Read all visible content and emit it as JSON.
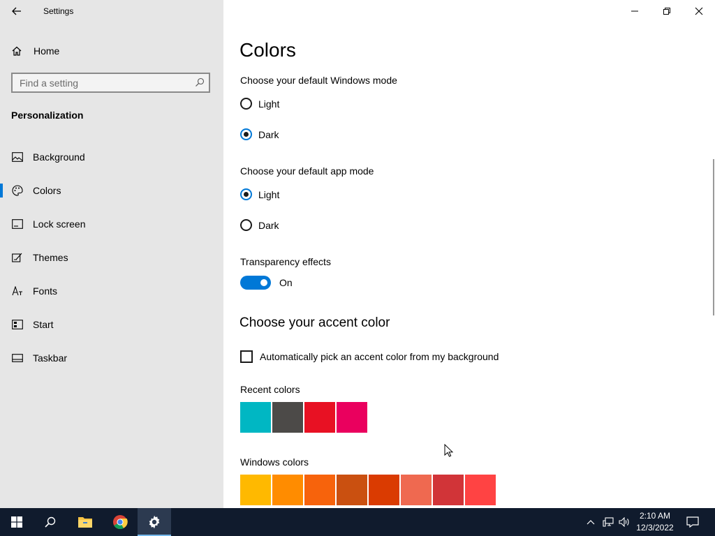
{
  "window": {
    "title": "Settings"
  },
  "sidebar": {
    "home_label": "Home",
    "search_placeholder": "Find a setting",
    "section_title": "Personalization",
    "items": [
      {
        "label": "Background",
        "icon": "image-icon"
      },
      {
        "label": "Colors",
        "icon": "palette-icon",
        "selected": true
      },
      {
        "label": "Lock screen",
        "icon": "lock-screen-icon"
      },
      {
        "label": "Themes",
        "icon": "themes-icon"
      },
      {
        "label": "Fonts",
        "icon": "fonts-icon"
      },
      {
        "label": "Start",
        "icon": "start-icon"
      },
      {
        "label": "Taskbar",
        "icon": "taskbar-icon"
      }
    ]
  },
  "main": {
    "title": "Colors",
    "windows_mode": {
      "label": "Choose your default Windows mode",
      "options": [
        "Light",
        "Dark"
      ],
      "selected": "Dark"
    },
    "app_mode": {
      "label": "Choose your default app mode",
      "options": [
        "Light",
        "Dark"
      ],
      "selected": "Light"
    },
    "transparency": {
      "label": "Transparency effects",
      "state": "On"
    },
    "accent_heading": "Choose your accent color",
    "auto_pick_label": "Automatically pick an accent color from my background",
    "recent_colors_label": "Recent colors",
    "recent_colors": [
      "#00b7c3",
      "#4c4a48",
      "#e81123",
      "#ea005e"
    ],
    "windows_colors_label": "Windows colors",
    "windows_colors": [
      "#ffb900",
      "#ff8c00",
      "#f7630c",
      "#ca5010",
      "#da3b01",
      "#ef6950",
      "#d13438",
      "#ff4343"
    ]
  },
  "taskbar": {
    "apps": [
      "start-icon",
      "search-icon",
      "file-explorer-icon",
      "chrome-icon",
      "settings-icon"
    ],
    "time": "2:10 AM",
    "date": "12/3/2022"
  },
  "colors": {
    "accent": "#0078d7",
    "sidebar_bg": "#e6e6e6",
    "taskbar_bg": "#101b2d"
  }
}
